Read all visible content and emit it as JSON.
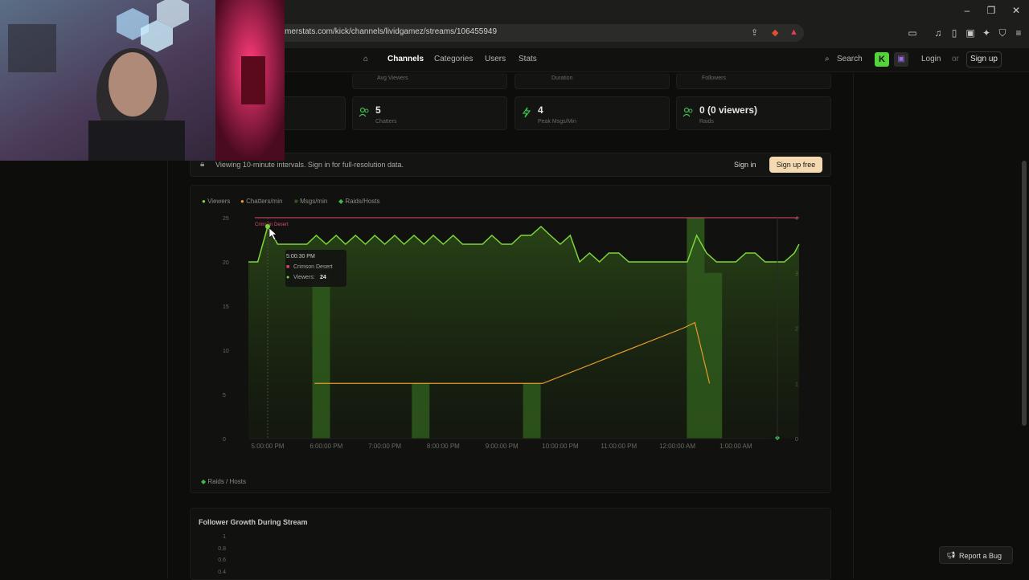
{
  "browser": {
    "url": "merstats.com/kick/channels/lividgamez/streams/106455949",
    "window_controls": [
      "minimize",
      "maximize",
      "close"
    ]
  },
  "nav": {
    "home_icon": "home-icon",
    "items": [
      "Channels",
      "Categories",
      "Users",
      "Stats"
    ],
    "active": "Channels",
    "search": "Search",
    "login": "Login",
    "or": "or",
    "signup": "Sign up"
  },
  "stats_top": [
    {
      "label": "Avg Viewers"
    },
    {
      "label": "Duration"
    },
    {
      "label": "Followers"
    }
  ],
  "stats": [
    {
      "value": "5",
      "label": "Chatters",
      "icon": "users-icon"
    },
    {
      "value": "4",
      "label": "Peak Msgs/Min",
      "icon": "bolt-icon"
    },
    {
      "value": "0 (0 viewers)",
      "label": "Raids",
      "icon": "users-icon"
    }
  ],
  "banner": {
    "text": "Viewing 10-minute intervals. Sign in for full-resolution data.",
    "signin": "Sign in",
    "signup_free": "Sign up free",
    "icon": "lock-icon"
  },
  "chart_data": {
    "type": "line",
    "legend": [
      "Viewers",
      "Chatters/min",
      "Msgs/min",
      "Raids/Hosts"
    ],
    "colors": {
      "viewers": "#7fd63a",
      "chatters": "#e89a2c",
      "msgs": "#2f5a1c",
      "raids": "#3dbb4a",
      "category": "#e04a6a"
    },
    "y_left_ticks": [
      "25",
      "20",
      "15",
      "10",
      "5",
      "0"
    ],
    "y_right_ticks": [
      "4",
      "3",
      "2",
      "1",
      "0"
    ],
    "y_left_range": [
      0,
      25
    ],
    "y_right_range": [
      0,
      4
    ],
    "x_ticks": [
      "5:00:00 PM",
      "6:00:00 PM",
      "7:00:00 PM",
      "8:00:00 PM",
      "9:00:00 PM",
      "10:00:00 PM",
      "11:00:00 PM",
      "12:00:00 AM",
      "1:00:00 AM"
    ],
    "x_range_hours": [
      16.67,
      25.6
    ],
    "viewers": [
      [
        16.67,
        20
      ],
      [
        16.83,
        20
      ],
      [
        17.0,
        24
      ],
      [
        17.17,
        22
      ],
      [
        17.33,
        22
      ],
      [
        17.5,
        22
      ],
      [
        17.67,
        22
      ],
      [
        17.83,
        23
      ],
      [
        18.0,
        22
      ],
      [
        18.17,
        23
      ],
      [
        18.33,
        22
      ],
      [
        18.5,
        23
      ],
      [
        18.67,
        22
      ],
      [
        18.83,
        23
      ],
      [
        19.0,
        22
      ],
      [
        19.17,
        23
      ],
      [
        19.33,
        22
      ],
      [
        19.5,
        23
      ],
      [
        19.67,
        22
      ],
      [
        19.83,
        23
      ],
      [
        20.0,
        22
      ],
      [
        20.17,
        23
      ],
      [
        20.33,
        22
      ],
      [
        20.5,
        22
      ],
      [
        20.67,
        22
      ],
      [
        20.83,
        23
      ],
      [
        21.0,
        22
      ],
      [
        21.17,
        22
      ],
      [
        21.33,
        23
      ],
      [
        21.5,
        23
      ],
      [
        21.67,
        24
      ],
      [
        21.83,
        23
      ],
      [
        22.0,
        22
      ],
      [
        22.17,
        23
      ],
      [
        22.33,
        20
      ],
      [
        22.5,
        21
      ],
      [
        22.67,
        20
      ],
      [
        22.83,
        21
      ],
      [
        23.0,
        21
      ],
      [
        23.17,
        20
      ],
      [
        23.33,
        20
      ],
      [
        23.5,
        20
      ],
      [
        23.67,
        20
      ],
      [
        23.83,
        20
      ],
      [
        24.0,
        20
      ],
      [
        24.17,
        20
      ],
      [
        24.33,
        23
      ],
      [
        24.5,
        21
      ],
      [
        24.67,
        20
      ],
      [
        24.83,
        20
      ],
      [
        25.0,
        20
      ],
      [
        25.17,
        21
      ],
      [
        25.33,
        21
      ],
      [
        25.5,
        20
      ],
      [
        25.67,
        20
      ],
      [
        25.83,
        20
      ],
      [
        26.0,
        21
      ],
      [
        26.08,
        22
      ]
    ],
    "chatters": [
      [
        17.8,
        1
      ],
      [
        19.6,
        1
      ],
      [
        21.5,
        1
      ],
      [
        21.7,
        1
      ],
      [
        24.1,
        2
      ],
      [
        24.3,
        2.1
      ],
      [
        24.55,
        1
      ]
    ],
    "msgs_bars": [
      [
        17.9,
        3
      ],
      [
        19.6,
        1
      ],
      [
        21.5,
        1
      ],
      [
        24.3,
        4
      ],
      [
        24.6,
        3
      ]
    ],
    "category": "Crimson Desert",
    "tooltip": {
      "time": "5:00:30 PM",
      "category": "Crimson Desert",
      "viewers_label": "Viewers:",
      "viewers": "24"
    },
    "footer_legend": "Raids / Hosts"
  },
  "follower": {
    "title": "Follower Growth During Stream",
    "ticks": [
      "1",
      "0.8",
      "0.6",
      "0.4"
    ]
  },
  "report_bug": "Report a Bug"
}
